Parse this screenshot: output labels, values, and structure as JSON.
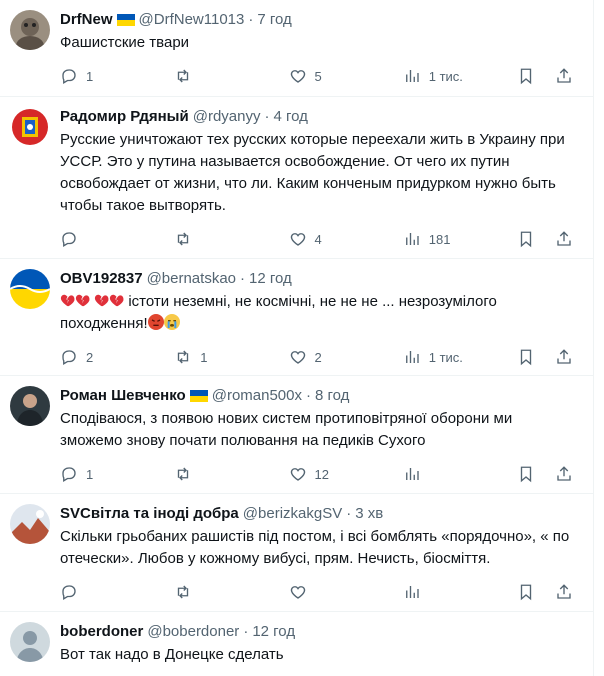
{
  "tweets": [
    {
      "name": "DrfNew",
      "flag": true,
      "handle": "@DrfNew11013",
      "dot": "·",
      "time": "7 год",
      "text": "Фашистские твари",
      "replies": "1",
      "retweets": "",
      "likes": "5",
      "views": "1 тис.",
      "avatar_color": "#8a7f72"
    },
    {
      "name": "Радомир Рдяный",
      "flag": false,
      "handle": "@rdyanyy",
      "dot": "·",
      "time": "4 год",
      "text": "Русские уничтожают тех русских которые переехали жить в Украину при УССР. Это у путина называется освобождение. От чего их путин освобождает от жизни, что ли. Каким конченым придурком нужно быть чтобы такое вытворять.",
      "replies": "",
      "retweets": "",
      "likes": "4",
      "views": "181",
      "avatar_color": "#d62828"
    },
    {
      "name": "OBV192837",
      "flag": false,
      "handle": "@bernatskao",
      "dot": "·",
      "time": "12 год",
      "text_pre": "",
      "text": "істоти неземні, не космічні, не не не ... незрозумілого походження!",
      "replies": "2",
      "retweets": "1",
      "likes": "2",
      "views": "1 тис.",
      "avatar_color": "#2c6fd6"
    },
    {
      "name": "Роман Шевченко",
      "flag": true,
      "handle": "@roman500x",
      "dot": "·",
      "time": "8 год",
      "text": "Сподіваюся, з появою нових систем протиповітряної оборони ми зможемо знову почати полювання на педиків Сухого",
      "replies": "1",
      "retweets": "",
      "likes": "12",
      "views": "",
      "avatar_color": "#3e4a52"
    },
    {
      "name": "SVСвітла та іноді добра",
      "flag": false,
      "handle": "@berizkakgSV",
      "dot": "·",
      "time": "3 хв",
      "text": "Скільки грьобаних рашистів під постом, і всі бомблять «порядочно», « по отечески». Любов у кожному вибусі, прям. Нечисть, біосміття.",
      "replies": "",
      "retweets": "",
      "likes": "",
      "views": "",
      "avatar_color": "#b5543a"
    },
    {
      "name": "boberdoner",
      "flag": false,
      "handle": "@boberdoner",
      "dot": "·",
      "time": "12 год",
      "text": "Вот так надо в  Донецке сделать",
      "avatar_color": "#cfd9de"
    }
  ]
}
